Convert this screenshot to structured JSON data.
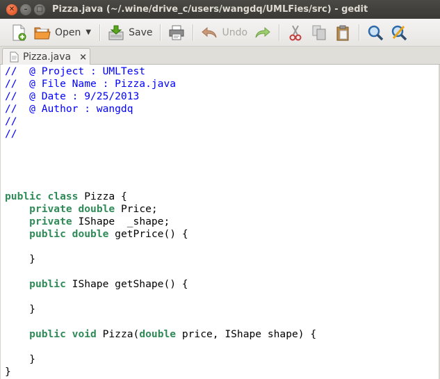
{
  "window": {
    "title": "Pizza.java (~/.wine/drive_c/users/wangdq/UMLFies/src) - gedit"
  },
  "toolbar": {
    "open_label": "Open",
    "save_label": "Save",
    "undo_label": "Undo"
  },
  "tabs": [
    {
      "label": "Pizza.java",
      "close": "×"
    }
  ],
  "code_lines": [
    [
      {
        "t": "cmt",
        "v": "//  @ Project : UMLTest"
      }
    ],
    [
      {
        "t": "cmt",
        "v": "//  @ File Name : Pizza.java"
      }
    ],
    [
      {
        "t": "cmt",
        "v": "//  @ Date : 9/25/2013"
      }
    ],
    [
      {
        "t": "cmt",
        "v": "//  @ Author : wangdq"
      }
    ],
    [
      {
        "t": "cmt",
        "v": "//"
      }
    ],
    [
      {
        "t": "cmt",
        "v": "//"
      }
    ],
    [],
    [],
    [],
    [],
    [
      {
        "t": "kw",
        "v": "public"
      },
      {
        "t": "plain",
        "v": " "
      },
      {
        "t": "kw",
        "v": "class"
      },
      {
        "t": "plain",
        "v": " Pizza {"
      }
    ],
    [
      {
        "t": "plain",
        "v": "    "
      },
      {
        "t": "kw",
        "v": "private"
      },
      {
        "t": "plain",
        "v": " "
      },
      {
        "t": "kw",
        "v": "double"
      },
      {
        "t": "plain",
        "v": " Price;"
      }
    ],
    [
      {
        "t": "plain",
        "v": "    "
      },
      {
        "t": "kw",
        "v": "private"
      },
      {
        "t": "plain",
        "v": " IShape  _shape;"
      }
    ],
    [
      {
        "t": "plain",
        "v": "    "
      },
      {
        "t": "kw",
        "v": "public"
      },
      {
        "t": "plain",
        "v": " "
      },
      {
        "t": "kw",
        "v": "double"
      },
      {
        "t": "plain",
        "v": " getPrice() {"
      }
    ],
    [],
    [
      {
        "t": "plain",
        "v": "    }"
      }
    ],
    [],
    [
      {
        "t": "plain",
        "v": "    "
      },
      {
        "t": "kw",
        "v": "public"
      },
      {
        "t": "plain",
        "v": " IShape getShape() {"
      }
    ],
    [],
    [
      {
        "t": "plain",
        "v": "    }"
      }
    ],
    [],
    [
      {
        "t": "plain",
        "v": "    "
      },
      {
        "t": "kw",
        "v": "public"
      },
      {
        "t": "plain",
        "v": " "
      },
      {
        "t": "kw",
        "v": "void"
      },
      {
        "t": "plain",
        "v": " Pizza("
      },
      {
        "t": "kw",
        "v": "double"
      },
      {
        "t": "plain",
        "v": " price, IShape shape) {"
      }
    ],
    [],
    [
      {
        "t": "plain",
        "v": "    }"
      }
    ],
    [
      {
        "t": "plain",
        "v": "}"
      }
    ]
  ]
}
